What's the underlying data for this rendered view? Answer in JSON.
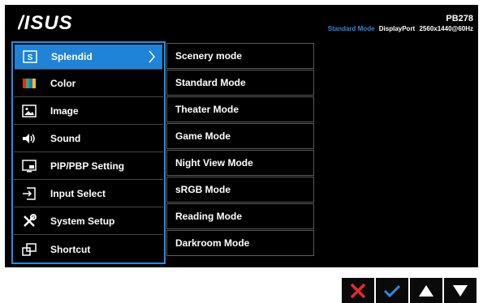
{
  "header": {
    "logo_text": "ASUS",
    "model": "PB278",
    "status": {
      "mode": "Standard Mode",
      "input": "DisplayPort",
      "resolution": "2560x1440@60Hz"
    }
  },
  "menu": {
    "items": [
      {
        "label": "Splendid",
        "icon": "splendid-s-icon",
        "selected": true
      },
      {
        "label": "Color",
        "icon": "color-bars-icon"
      },
      {
        "label": "Image",
        "icon": "image-icon"
      },
      {
        "label": "Sound",
        "icon": "speaker-icon"
      },
      {
        "label": "PIP/PBP Setting",
        "icon": "pip-icon"
      },
      {
        "label": "Input Select",
        "icon": "input-select-icon"
      },
      {
        "label": "System Setup",
        "icon": "tools-icon"
      },
      {
        "label": "Shortcut",
        "icon": "shortcut-icon"
      }
    ]
  },
  "submenu": {
    "items": [
      "Scenery mode",
      "Standard Mode",
      "Theater Mode",
      "Game Mode",
      "Night View Mode",
      "sRGB Mode",
      "Reading Mode",
      "Darkroom Mode"
    ]
  },
  "keys": [
    {
      "icon": "close-x-icon",
      "color": "#e32b2b"
    },
    {
      "icon": "checkmark-icon",
      "color": "#2a8bde"
    },
    {
      "icon": "arrow-up-icon",
      "color": "#ffffff"
    },
    {
      "icon": "arrow-down-icon",
      "color": "#ffffff"
    }
  ],
  "colors": {
    "accent": "#2a8bde",
    "osd_background": "#000000",
    "cancel": "#e32b2b"
  }
}
